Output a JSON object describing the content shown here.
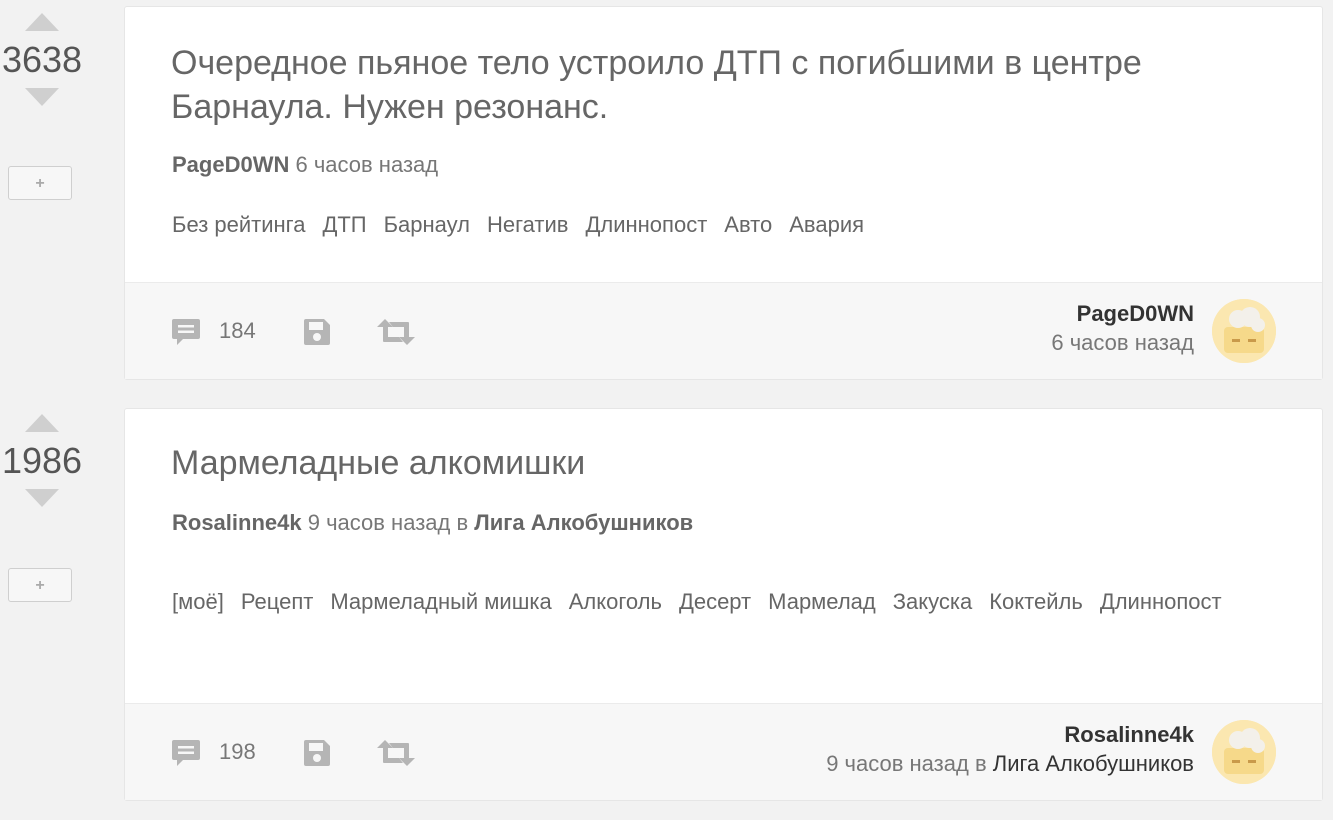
{
  "posts": [
    {
      "rating": "3638",
      "plus_label": "+",
      "title": "Очередное пьяное тело устроило ДТП с погибшими в центре Барнаула. Нужен резонанс.",
      "author": "PageD0WN",
      "time": "6 часов назад",
      "community_prefix": "",
      "community": "",
      "tags": [
        "Без рейтинга",
        "ДТП",
        "Барнаул",
        "Негатив",
        "Длиннопост",
        "Авто",
        "Авария"
      ],
      "comments": "184",
      "footer_author": "PageD0WN",
      "footer_time": "6 часов назад",
      "footer_community_prefix": "",
      "footer_community": ""
    },
    {
      "rating": "1986",
      "plus_label": "+",
      "title": "Мармеладные алкомишки",
      "author": "Rosalinne4k",
      "time": "9 часов назад",
      "community_prefix": "в",
      "community": "Лига Алкобушников",
      "tags": [
        "[моё]",
        "Рецепт",
        "Мармеладный мишка",
        "Алкоголь",
        "Десерт",
        "Мармелад",
        "Закуска",
        "Коктейль",
        "Длиннопост"
      ],
      "comments": "198",
      "footer_author": "Rosalinne4k",
      "footer_time": "9 часов назад",
      "footer_community_prefix": "в",
      "footer_community": "Лига Алкобушников"
    }
  ],
  "icons": {
    "comments": "comment-icon",
    "save": "save-icon",
    "share": "repost-icon",
    "avatar": "avatar-image"
  },
  "colors": {
    "background": "#f2f2f2",
    "card": "#ffffff",
    "footer": "#f7f7f7",
    "icon": "#b5b5b5"
  }
}
